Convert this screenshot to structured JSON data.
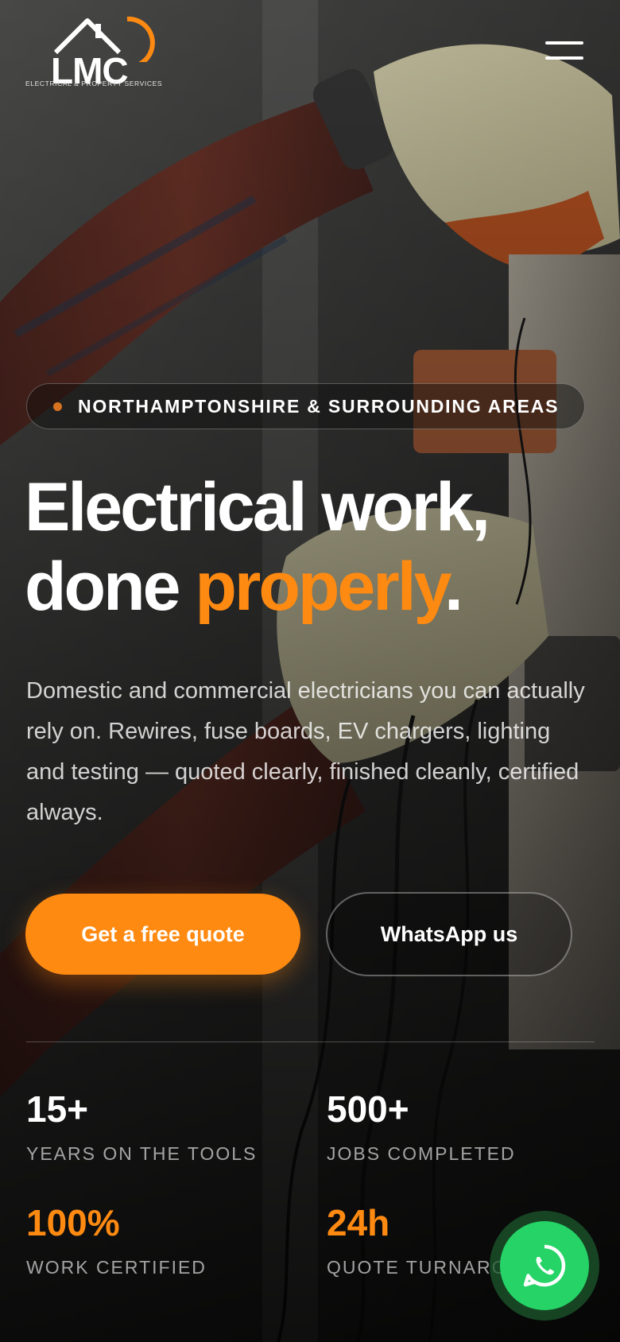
{
  "header": {
    "logo_text": "LMC",
    "logo_tagline": "ELECTRICAL & PROPERTY SERVICES"
  },
  "hero": {
    "location_pill": "NORTHAMPTONSHIRE & SURROUNDING AREAS",
    "headline_line1": "Electrical work,",
    "headline_line2_start": "done ",
    "headline_accent": "properly",
    "headline_end": ".",
    "lead": "Domestic and commercial electricians you can actually rely on. Rewires, fuse boards, EV chargers, lighting and testing — quoted clearly, finished cleanly, certified always.",
    "primary_cta": "Get a free quote",
    "secondary_cta": "WhatsApp us"
  },
  "stats": [
    {
      "value": "15+",
      "label": "YEARS ON THE TOOLS"
    },
    {
      "value": "500+",
      "label": "JOBS COMPLETED"
    },
    {
      "value": "100%",
      "label": "WORK CERTIFIED"
    },
    {
      "value": "24h",
      "label": "QUOTE TURNARO"
    }
  ],
  "colors": {
    "accent": "#ff8a12",
    "whatsapp": "#25d366",
    "pill_dot": "#d9731f"
  },
  "icons": {
    "menu": "hamburger-menu-icon",
    "whatsapp": "whatsapp-icon",
    "logo_house": "house-roof-icon"
  }
}
